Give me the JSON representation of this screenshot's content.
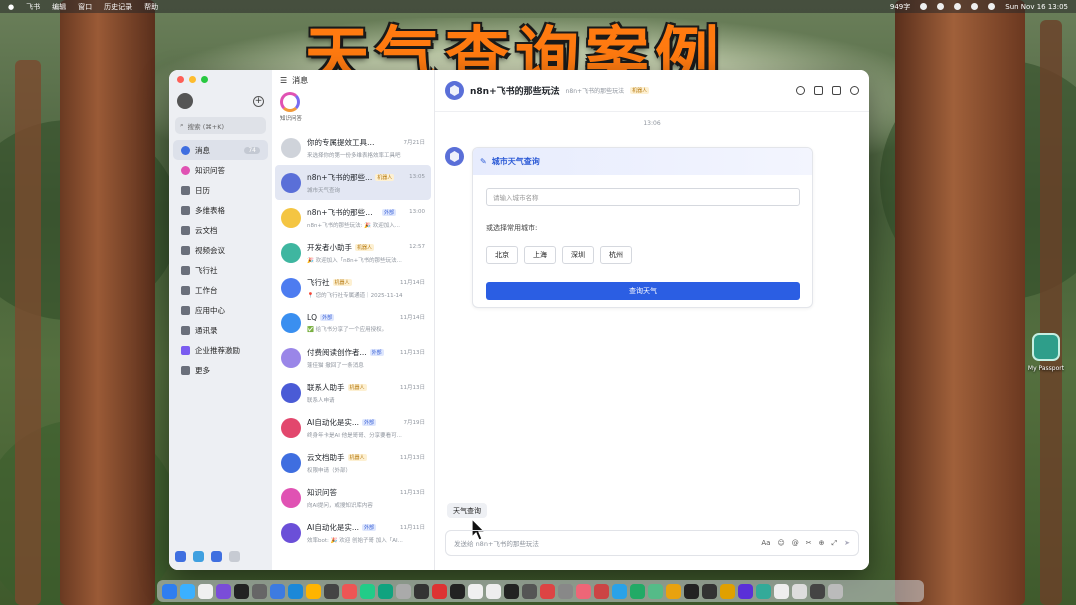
{
  "overlay_title": "天气查询案例",
  "menubar": {
    "items": [
      "飞书",
      "编辑",
      "窗口",
      "历史记录",
      "帮助"
    ],
    "wordcount": "949字",
    "datetime": "Sun Nov 16  13:05"
  },
  "nav": {
    "search_placeholder": "搜索 (⌘+K)",
    "items": [
      {
        "label": "消息",
        "badge": "74"
      },
      {
        "label": "知识问答"
      },
      {
        "label": "日历"
      },
      {
        "label": "多维表格"
      },
      {
        "label": "云文档"
      },
      {
        "label": "视频会议"
      },
      {
        "label": "飞行社"
      },
      {
        "label": "工作台"
      },
      {
        "label": "应用中心"
      },
      {
        "label": "通讯录"
      },
      {
        "label": "企业推荐激励"
      },
      {
        "label": "更多"
      }
    ]
  },
  "chatlist": {
    "header": "消息",
    "kb_label": "知识问答",
    "chats": [
      {
        "name": "你的专属提效工具推荐",
        "tag": "",
        "time": "7月21日",
        "preview": "来选择你的第一份多维表格效率工具吧",
        "color": "#cfd3da"
      },
      {
        "name": "n8n+飞书的那些...",
        "tag": "机器人",
        "time": "13:05",
        "preview": "城市天气查询",
        "color": "#5a6fd8"
      },
      {
        "name": "n8n+飞书的那些玩法",
        "tag": "外部",
        "time": "13:00",
        "preview": "n8n+飞书的那些玩法: 🎉 欢迎加入...",
        "color": "#f4c542"
      },
      {
        "name": "开发者小助手",
        "tag": "机器人",
        "time": "12:57",
        "preview": "🎉 欢迎加入「n8n+飞书的那些玩法...",
        "color": "#3fb6a0"
      },
      {
        "name": "飞行社",
        "tag": "机器人",
        "time": "11月14日",
        "preview": "📍 您的飞行社专属通道｜2025-11-14",
        "color": "#4d7cf0"
      },
      {
        "name": "LQ",
        "tag": "外部",
        "time": "11月14日",
        "preview": "✅ 给飞书分享了一个应用授权。",
        "color": "#3a8ff0"
      },
      {
        "name": "付费阅读创作者...",
        "tag": "外部",
        "time": "11月13日",
        "preview": "蓬佳猫 撤回了一条消息",
        "color": "#9a86e8"
      },
      {
        "name": "联系人助手",
        "tag": "机器人",
        "time": "11月13日",
        "preview": "联系人申请",
        "color": "#4a5bd6"
      },
      {
        "name": "AI自动化是实...",
        "tag": "外部",
        "time": "7月19日",
        "preview": "终身年卡是AI 他是哥哥、分享要看可...",
        "color": "#e2476d"
      },
      {
        "name": "云文档助手",
        "tag": "机器人",
        "time": "11月13日",
        "preview": "权限申请（外部）",
        "color": "#3f6ee0"
      },
      {
        "name": "知识问答",
        "tag": "",
        "time": "11月13日",
        "preview": "向AI提问，或搜知识库内容",
        "color": "#e052b3"
      },
      {
        "name": "AI自动化是实...",
        "tag": "外部",
        "time": "11月11日",
        "preview": "效率bot: 🎉 欢迎 创始子哥 加入「AI...",
        "color": "#6b4fd8"
      }
    ]
  },
  "conversation": {
    "title": "n8n+飞书的那些玩法",
    "subtitle": "n8n+飞书的那些玩法",
    "tag": "机器人",
    "timestamp": "13:06",
    "card": {
      "title": "城市天气查询",
      "input_placeholder": "请输入城市名称",
      "choose_label": "或选择常用城市:",
      "cities": [
        "北京",
        "上海",
        "深圳",
        "杭州"
      ],
      "query_button": "查询天气"
    },
    "shortcut_chip": "天气查询",
    "composer_placeholder": "发送给 n8n+飞书的那些玩法",
    "composer_tools": [
      "Aa",
      "☺",
      "@",
      "✂",
      "⊕",
      "⤢",
      "➤"
    ]
  },
  "desktop_icon_label": "My Passport",
  "colors": {
    "accent": "#2b5ee3",
    "overlay_title": "#ff7a10"
  }
}
